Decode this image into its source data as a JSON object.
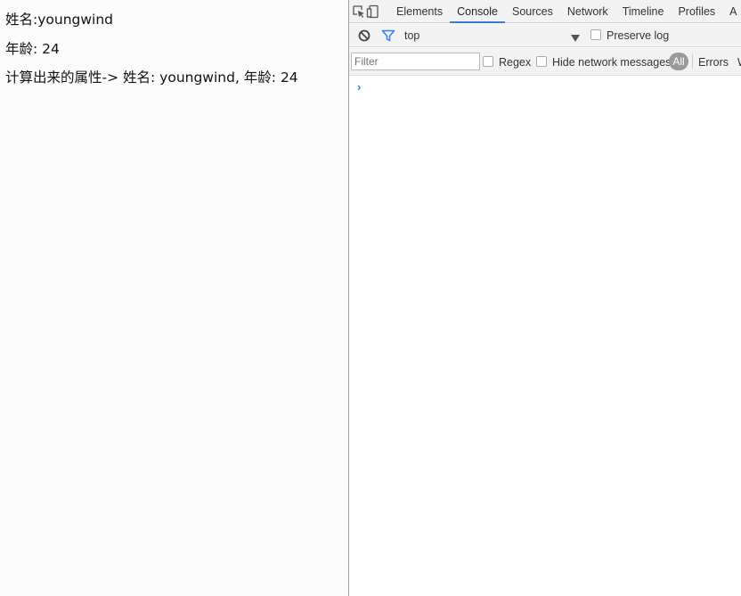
{
  "page": {
    "line1": "姓名:youngwind",
    "line2": "年龄: 24",
    "line3": "计算出来的属性-> 姓名: youngwind, 年龄: 24"
  },
  "devtools": {
    "tabs": [
      "Elements",
      "Console",
      "Sources",
      "Network",
      "Timeline",
      "Profiles",
      "A"
    ],
    "active_tab": "Console",
    "context": "top",
    "preserve_log": "Preserve log",
    "filter_placeholder": "Filter",
    "regex": "Regex",
    "hide_network": "Hide network messages",
    "level_all": "All",
    "level_errors": "Errors",
    "level_next": "W",
    "prompt": "›"
  },
  "colors": {
    "accent": "#3879d9",
    "filter_icon": "#3b7ddd"
  }
}
